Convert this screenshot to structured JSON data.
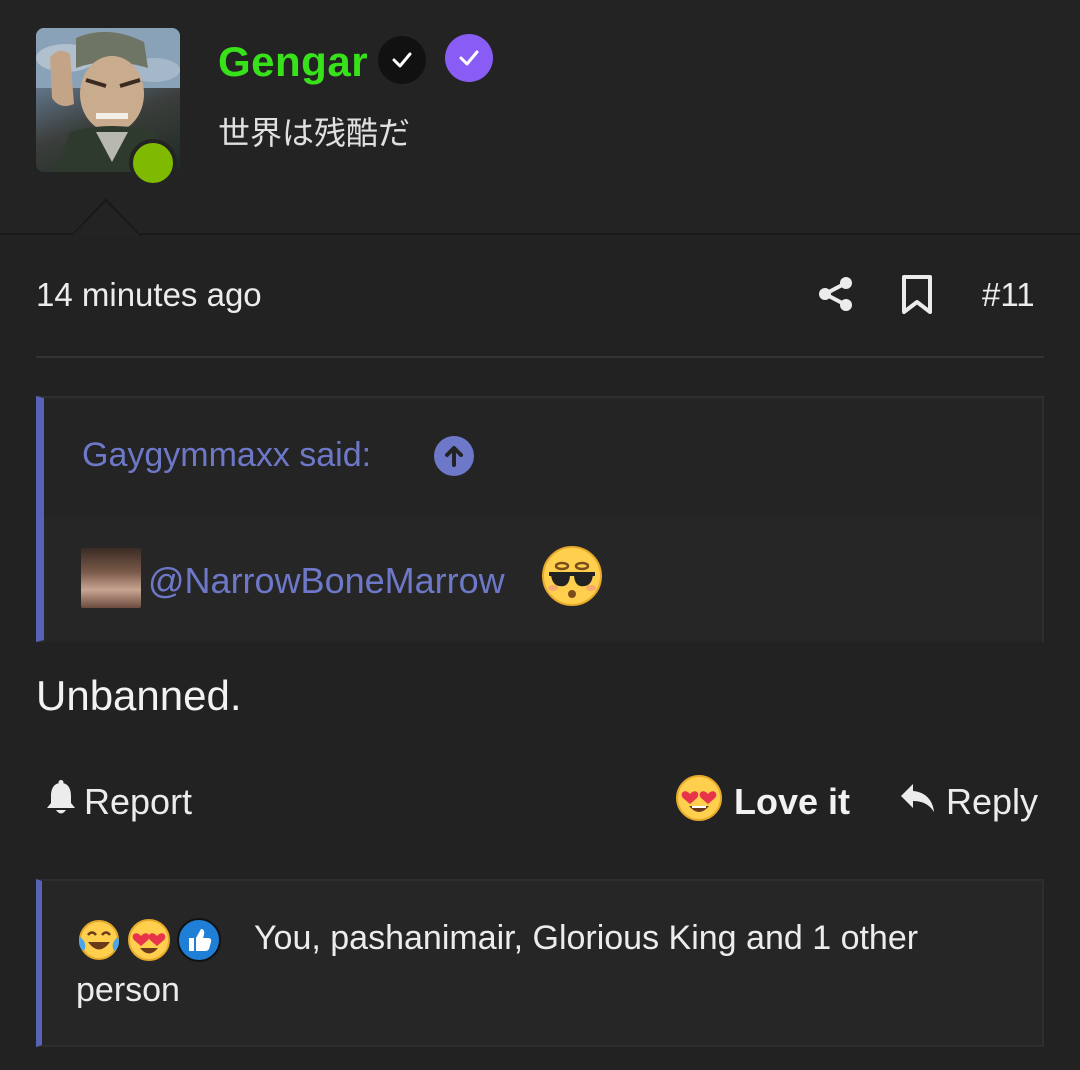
{
  "author": {
    "username": "Gengar",
    "title": "世界は残酷だ",
    "username_color": "#38e21a",
    "online_color": "#7fba00"
  },
  "post": {
    "time": "14 minutes ago",
    "number": "#11",
    "body": "Unbanned."
  },
  "quote": {
    "author_label": "Gaygymmaxx said:",
    "mention": "@NarrowBoneMarrow",
    "accent_color": "#6e78c8"
  },
  "actions": {
    "report": "Report",
    "love": "Love it",
    "reply": "Reply"
  },
  "reactions": {
    "line1": "You, pashanimair, Glorious King and 1 other",
    "line2": "person"
  },
  "icons": [
    "verified-black-icon",
    "verified-purple-icon",
    "share-icon",
    "bookmark-icon",
    "arrow-up-icon",
    "bell-icon",
    "heart-eyes-emoji",
    "reply-arrow-icon",
    "crying-laughing-emoji",
    "thumbs-up-icon"
  ]
}
